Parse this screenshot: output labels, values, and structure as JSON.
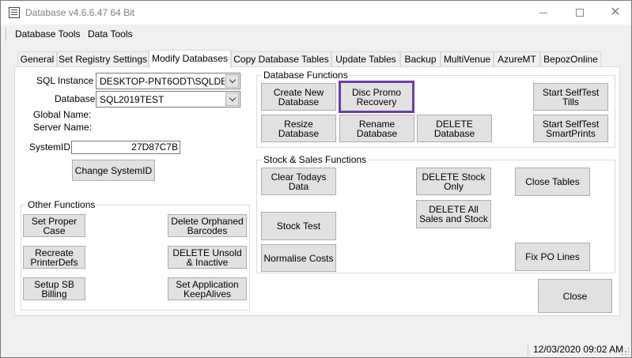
{
  "window": {
    "title": "Database v4.6.6.47 64 Bit"
  },
  "menu": {
    "items": [
      "Database Tools",
      "Data Tools"
    ]
  },
  "tabs": [
    "General",
    "Set Registry Settings",
    "Modify Databases",
    "Copy Database Tables",
    "Update Tables",
    "Backup",
    "MultiVenue",
    "AzureMT",
    "BepozOnline"
  ],
  "active_tab": "Modify Databases",
  "connection": {
    "sql_instance_label": "SQL Instance :",
    "sql_instance_value": "DESKTOP-PNT6ODT\\SQLDE",
    "database_label": "Database:",
    "database_value": "SQL2019TEST",
    "global_name_label": "Global Name:",
    "server_name_label": "Server Name:",
    "system_id_label": "SystemID:",
    "system_id_value": "27D87C7B",
    "change_system_id": "Change SystemID"
  },
  "other_functions": {
    "title": "Other Functions",
    "set_proper_case": "Set Proper\nCase",
    "delete_orphaned_barcodes": "Delete Orphaned\nBarcodes",
    "recreate_printerdefs": "Recreate\nPrinterDefs",
    "delete_unsold_inactive": "DELETE Unsold\n& Inactive",
    "setup_sb_billing": "Setup SB\nBilling",
    "set_app_keepalives": "Set Application\nKeepAlives"
  },
  "database_functions": {
    "title": "Database Functions",
    "create_new_database": "Create New\nDatabase",
    "disc_promo_recovery": "Disc Promo\nRecovery",
    "start_selftest_tills": "Start SelfTest\nTills",
    "resize_database": "Resize\nDatabase",
    "rename_database": "Rename\nDatabase",
    "delete_database": "DELETE\nDatabase",
    "start_selftest_smartprints": "Start SelfTest\nSmartPrints"
  },
  "stock_sales_functions": {
    "title": "Stock & Sales Functions",
    "clear_todays_data": "Clear Todays\nData",
    "delete_stock_only": "DELETE Stock\nOnly",
    "close_tables": "Close Tables",
    "delete_all_sales_stock": "DELETE All\nSales and Stock",
    "stock_test": "Stock Test",
    "fix_po_lines": "Fix PO Lines",
    "normalise_costs": "Normalise Costs"
  },
  "close_button": "Close",
  "status": {
    "datetime": "12/03/2020 09:02 AM"
  },
  "colors": {
    "highlight_border": "#6b3fa0",
    "button_face": "#e1e1e1",
    "window_bg": "#f0f0f0"
  }
}
